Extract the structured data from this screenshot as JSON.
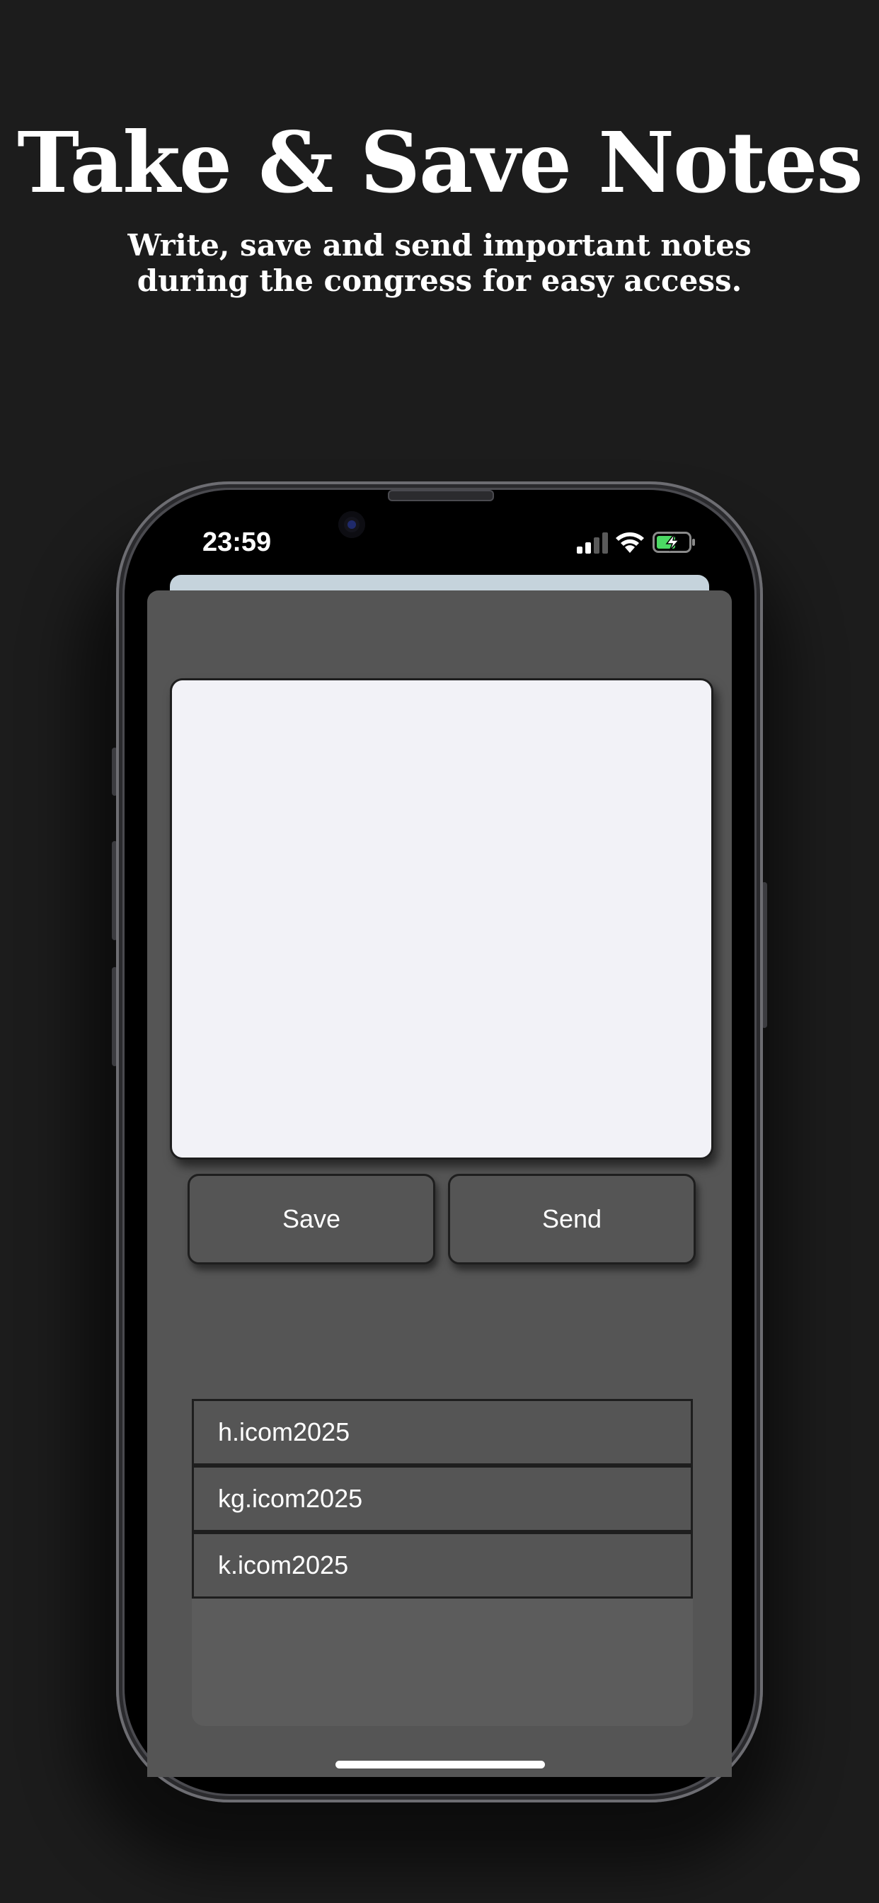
{
  "promo": {
    "title": "Take & Save Notes",
    "subtitle": "Write, save and send important notes during the congress for easy access."
  },
  "status_bar": {
    "time": "23:59",
    "icons": [
      "cellular-signal-icon",
      "wifi-icon",
      "battery-charging-icon"
    ],
    "battery_color": "#4cd964"
  },
  "note_editor": {
    "value": "",
    "background": "#f2f2f7"
  },
  "actions": {
    "save_label": "Save",
    "send_label": "Send"
  },
  "saved_notes": {
    "items": [
      {
        "label": "h.icom2025"
      },
      {
        "label": "kg.icom2025"
      },
      {
        "label": "k.icom2025"
      }
    ]
  },
  "colors": {
    "page_background": "#1c1c1c",
    "sheet_background": "#555555",
    "sheet_back": "#c5d3dc"
  }
}
